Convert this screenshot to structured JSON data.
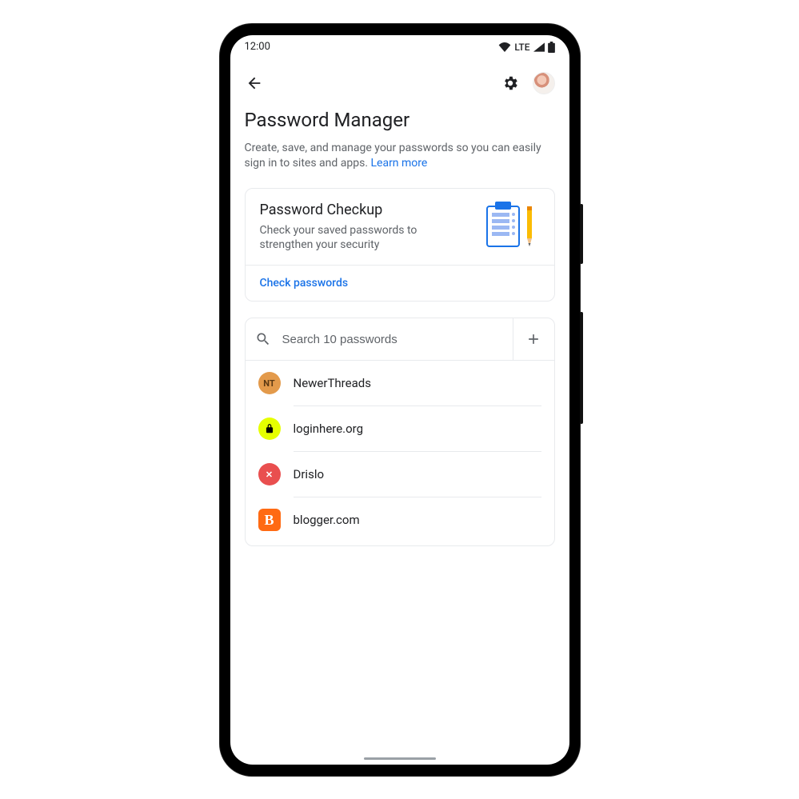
{
  "status": {
    "time": "12:00",
    "network": "LTE"
  },
  "page": {
    "title": "Password Manager",
    "description": "Create, save, and manage your passwords so you can easily sign in to sites and apps. ",
    "learn_more": "Learn more"
  },
  "checkup": {
    "title": "Password Checkup",
    "subtitle": "Check your saved passwords to strengthen your security",
    "action": "Check passwords"
  },
  "search": {
    "placeholder": "Search 10 passwords"
  },
  "passwords": [
    {
      "label": "NewerThreads",
      "icon_bg": "#e39a4b",
      "icon_fg": "#5a3813",
      "icon_text": "NT",
      "icon_shape": "text",
      "radius": "50%"
    },
    {
      "label": "loginhere.org",
      "icon_bg": "#e6ff00",
      "icon_fg": "#000000",
      "icon_text": "",
      "icon_shape": "lock",
      "radius": "50%"
    },
    {
      "label": "Drislo",
      "icon_bg": "#e94f4f",
      "icon_fg": "#ffffff",
      "icon_text": "✕",
      "icon_shape": "text",
      "radius": "50%"
    },
    {
      "label": "blogger.com",
      "icon_bg": "#ff6a13",
      "icon_fg": "#ffffff",
      "icon_text": "B",
      "icon_shape": "blogger",
      "radius": "6px"
    }
  ]
}
